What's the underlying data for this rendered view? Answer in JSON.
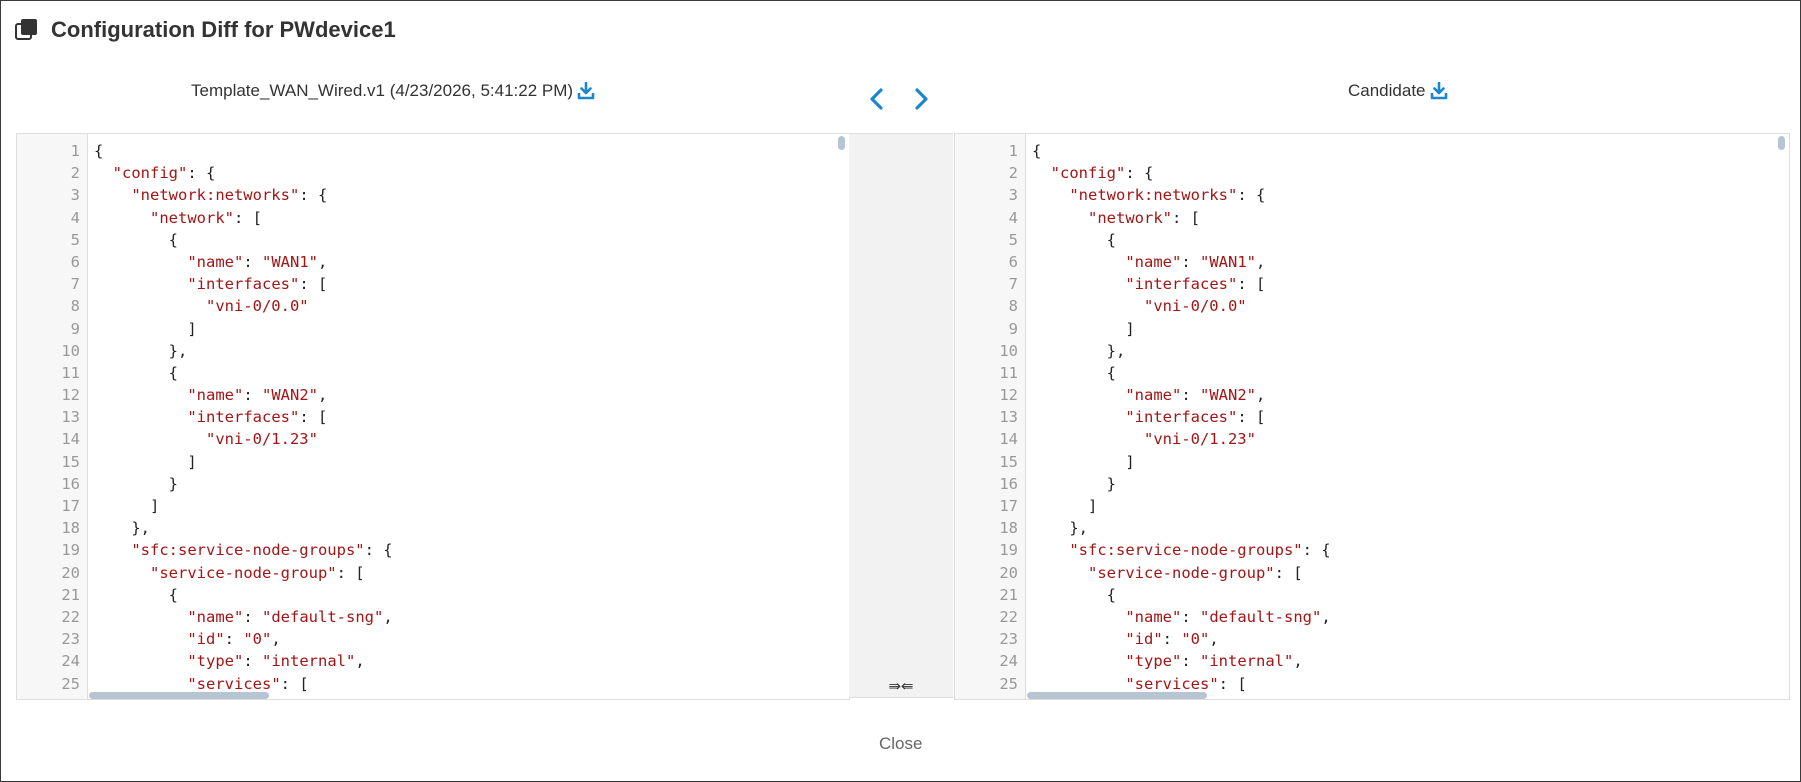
{
  "dialog": {
    "title": "Configuration Diff for PWdevice1",
    "close_label": "Close"
  },
  "colors": {
    "accent": "#1a86d0",
    "string": "#a31515",
    "line_number": "#999999"
  },
  "left_pane": {
    "header": "Template_WAN_Wired.v1 (4/23/2026, 5:41:22 PM)",
    "download_icon": "download-icon"
  },
  "right_pane": {
    "header": "Candidate",
    "download_icon": "download-icon"
  },
  "nav": {
    "prev_icon": "chevron-left-icon",
    "next_icon": "chevron-right-icon"
  },
  "merge_symbol": "⇛⇚",
  "code_lines": [
    {
      "n": "1",
      "text": "{"
    },
    {
      "n": "2",
      "text": "  \"config\": {"
    },
    {
      "n": "3",
      "text": "    \"network:networks\": {"
    },
    {
      "n": "4",
      "text": "      \"network\": ["
    },
    {
      "n": "5",
      "text": "        {"
    },
    {
      "n": "6",
      "text": "          \"name\": \"WAN1\","
    },
    {
      "n": "7",
      "text": "          \"interfaces\": ["
    },
    {
      "n": "8",
      "text": "            \"vni-0/0.0\""
    },
    {
      "n": "9",
      "text": "          ]"
    },
    {
      "n": "10",
      "text": "        },"
    },
    {
      "n": "11",
      "text": "        {"
    },
    {
      "n": "12",
      "text": "          \"name\": \"WAN2\","
    },
    {
      "n": "13",
      "text": "          \"interfaces\": ["
    },
    {
      "n": "14",
      "text": "            \"vni-0/1.23\""
    },
    {
      "n": "15",
      "text": "          ]"
    },
    {
      "n": "16",
      "text": "        }"
    },
    {
      "n": "17",
      "text": "      ]"
    },
    {
      "n": "18",
      "text": "    },"
    },
    {
      "n": "19",
      "text": "    \"sfc:service-node-groups\": {"
    },
    {
      "n": "20",
      "text": "      \"service-node-group\": ["
    },
    {
      "n": "21",
      "text": "        {"
    },
    {
      "n": "22",
      "text": "          \"name\": \"default-sng\","
    },
    {
      "n": "23",
      "text": "          \"id\": \"0\","
    },
    {
      "n": "24",
      "text": "          \"type\": \"internal\","
    },
    {
      "n": "25",
      "text": "          \"services\": ["
    }
  ]
}
